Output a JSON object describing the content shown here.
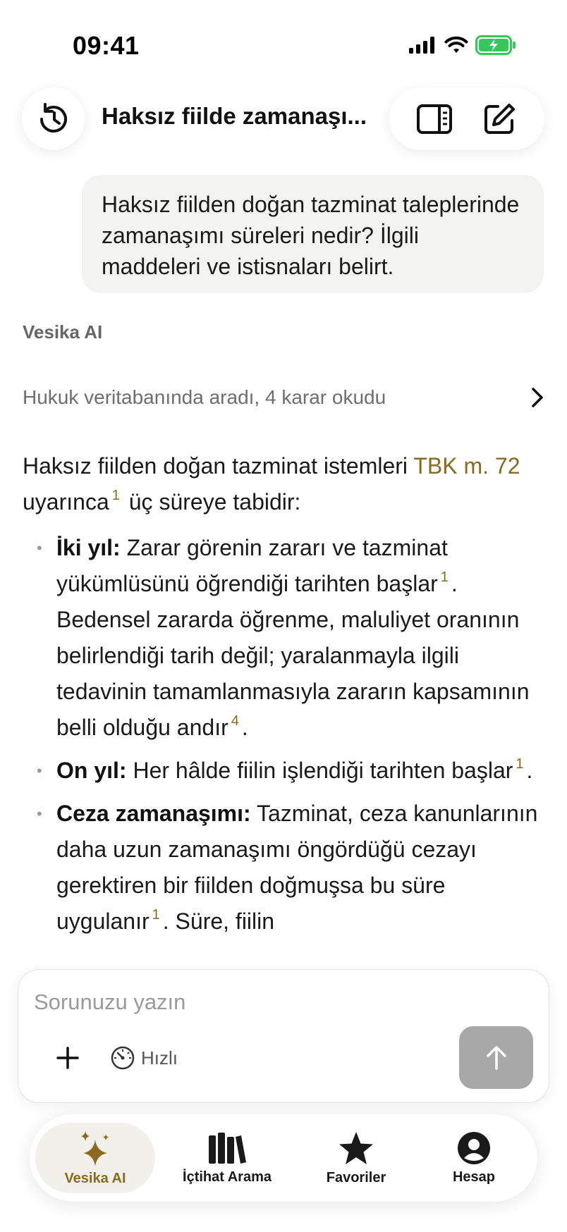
{
  "status_bar": {
    "time": "09:41"
  },
  "header": {
    "title": "Haksız fiilde zamanaşı..."
  },
  "user_message": "Haksız fiilden doğan tazminat taleplerinde zamanaşımı süreleri nedir? İlgili maddeleri ve istisnaları belirt.",
  "assistant": {
    "name": "Vesika AI",
    "search_summary": "Hukuk veritabanında aradı, 4 karar okudu",
    "intro_before": "Haksız fiilden doğan tazminat istemleri ",
    "intro_link": "TBK m. 72",
    "intro_mid": " uyarınca",
    "intro_cite": "1",
    "intro_after": " üç süreye tabidir:",
    "bullets": [
      {
        "title": "İki yıl:",
        "text1": " Zarar görenin zararı ve tazminat yükümlüsünü öğrendiği tarihten başlar",
        "cite1": "1",
        "text2": ". Bedensel zararda öğrenme, maluliyet oranının belirlendiği tarih değil; yaralanmayla ilgili tedavinin tamamlanmasıyla zararın kapsamının belli olduğu andır",
        "cite2": "4",
        "text3": "."
      },
      {
        "title": "On yıl:",
        "text1": " Her hâlde fiilin işlendiği tarihten başlar",
        "cite1": "1",
        "text2": "."
      },
      {
        "title": "Ceza zamanaşımı:",
        "text1": " Tazminat, ceza kanunlarının daha uzun zamanaşımı öngördüğü cezayı gerektiren bir fiilden doğmuşsa bu süre uygulanır",
        "cite1": "1",
        "text2": ". Süre, fiilin"
      }
    ]
  },
  "composer": {
    "placeholder": "Sorunuzu yazın",
    "mode_label": "Hızlı"
  },
  "nav": {
    "items": [
      {
        "label": "Vesika AI",
        "icon": "sparkles-icon",
        "active": true
      },
      {
        "label": "İçtihat Arama",
        "icon": "books-icon",
        "active": false
      },
      {
        "label": "Favoriler",
        "icon": "star-icon",
        "active": false
      },
      {
        "label": "Hesap",
        "icon": "account-icon",
        "active": false
      }
    ]
  },
  "colors": {
    "accent": "#8a6a1f",
    "battery_green": "#34c759",
    "send_disabled": "#a8a8a8"
  }
}
